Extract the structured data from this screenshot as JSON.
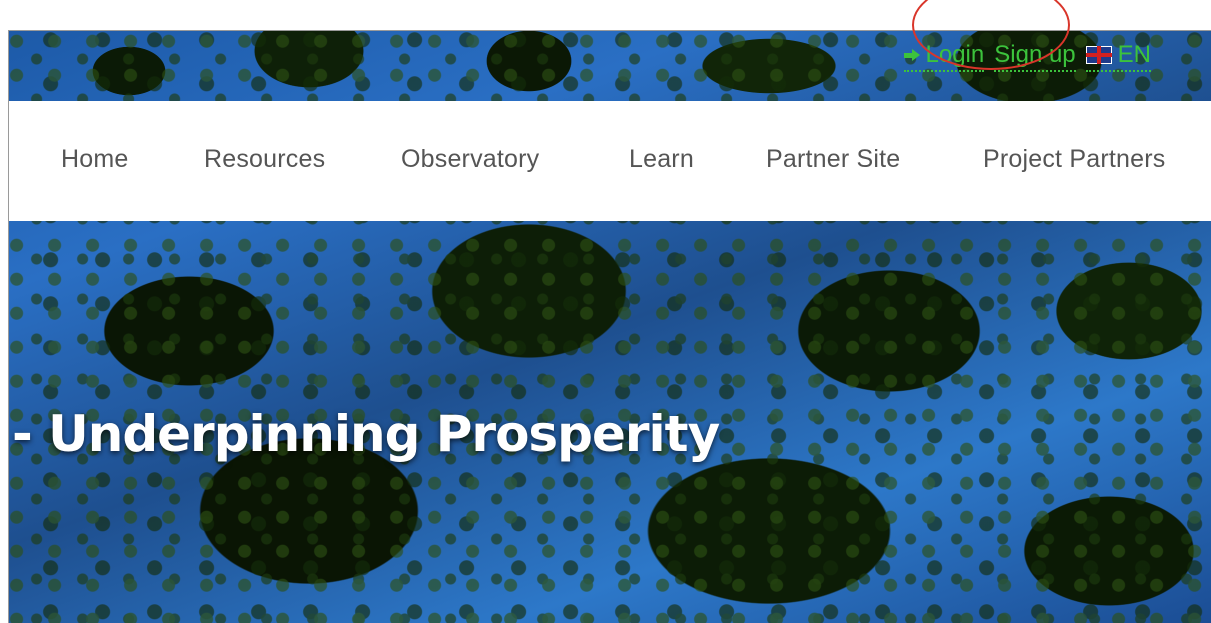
{
  "utility_bar": {
    "login_label": "Login",
    "signup_label": "Sign up",
    "language_label": "EN",
    "link_color": "#3cc33c",
    "highlight_color": "#d9352a"
  },
  "nav": {
    "items": [
      {
        "label": "Home"
      },
      {
        "label": "Resources"
      },
      {
        "label": "Observatory"
      },
      {
        "label": "Learn"
      },
      {
        "label": "Partner Site"
      },
      {
        "label": "Project Partners"
      }
    ]
  },
  "hero": {
    "title": "- Underpinning Prosperity"
  }
}
